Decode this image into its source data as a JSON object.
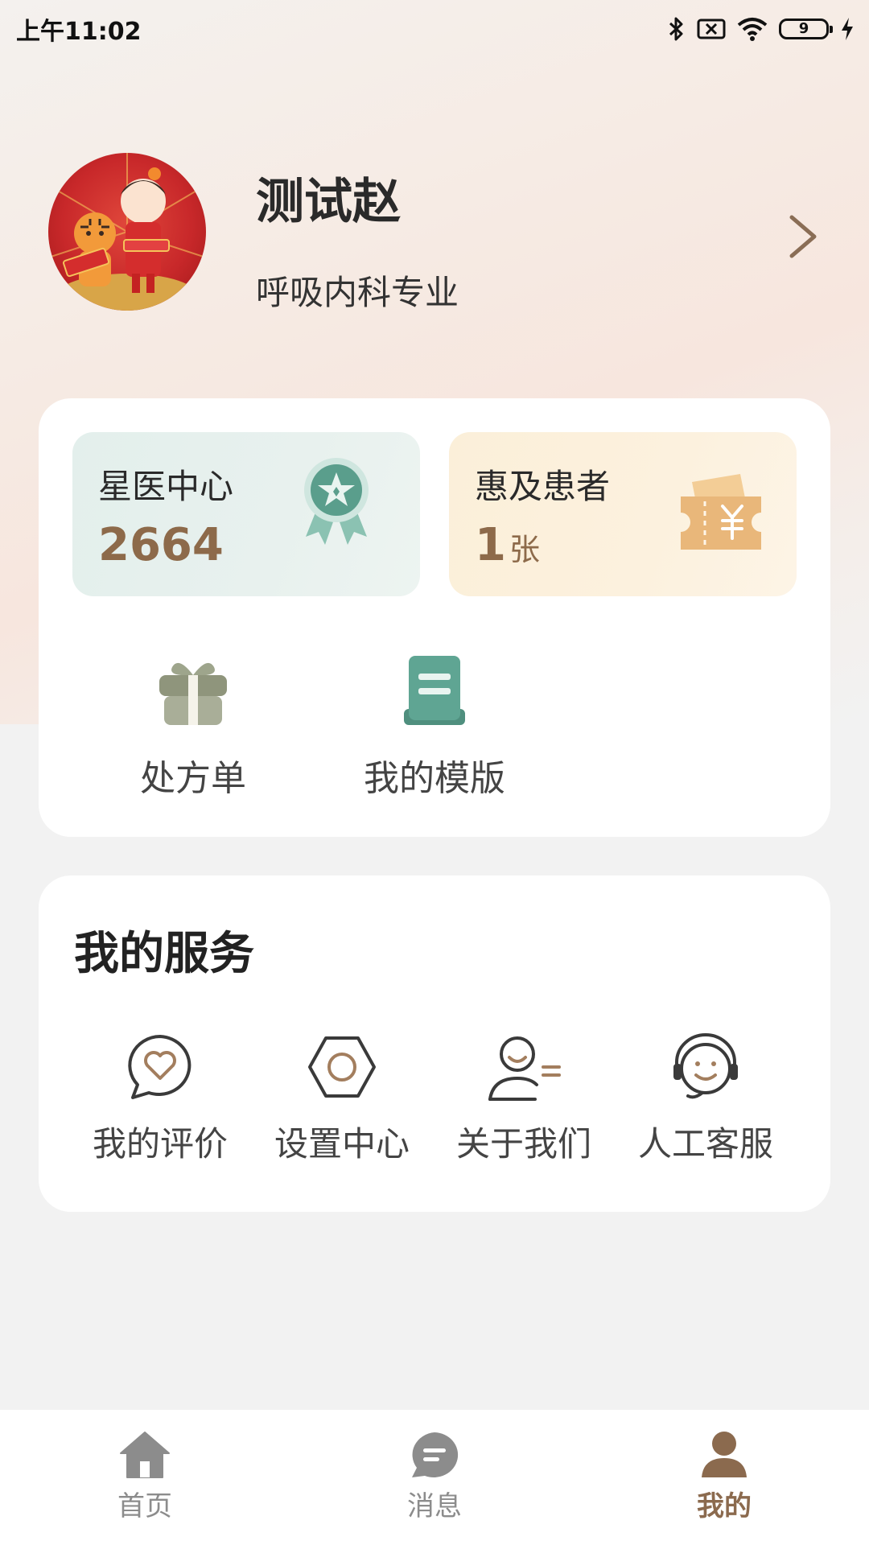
{
  "status_bar": {
    "time": "上午11:02",
    "battery": "9",
    "icons": [
      "bluetooth-icon",
      "no-sim-icon",
      "wifi-icon",
      "battery-icon",
      "charging-icon"
    ]
  },
  "profile": {
    "name": "测试赵",
    "department": "呼吸内科专业",
    "avatar_icon": "tiger-new-year-avatar"
  },
  "stats": {
    "star_doctor": {
      "title": "星医中心",
      "value": "2664",
      "icon": "award-ribbon-icon"
    },
    "coupon": {
      "title": "惠及患者",
      "value": "1",
      "unit": "张",
      "icon": "yuan-coupon-icon"
    }
  },
  "quick_actions": [
    {
      "label": "处方单",
      "icon": "gift-icon"
    },
    {
      "label": "我的模版",
      "icon": "document-icon"
    }
  ],
  "services": {
    "title": "我的服务",
    "items": [
      {
        "label": "我的评价",
        "icon": "heart-chat-icon"
      },
      {
        "label": "设置中心",
        "icon": "hexagon-settings-icon"
      },
      {
        "label": "关于我们",
        "icon": "person-info-icon"
      },
      {
        "label": "人工客服",
        "icon": "headset-agent-icon"
      }
    ]
  },
  "tab_bar": {
    "items": [
      {
        "label": "首页",
        "icon": "home-icon",
        "active": false
      },
      {
        "label": "消息",
        "icon": "chat-bubble-icon",
        "active": false
      },
      {
        "label": "我的",
        "icon": "user-icon",
        "active": true
      }
    ],
    "active_color": "#8b6a4e",
    "inactive_color": "#8c8c8c"
  },
  "colors": {
    "accent_brown": "#8d6a4a",
    "teal": "#5a9e8c",
    "coupon_orange": "#e9b77a"
  }
}
